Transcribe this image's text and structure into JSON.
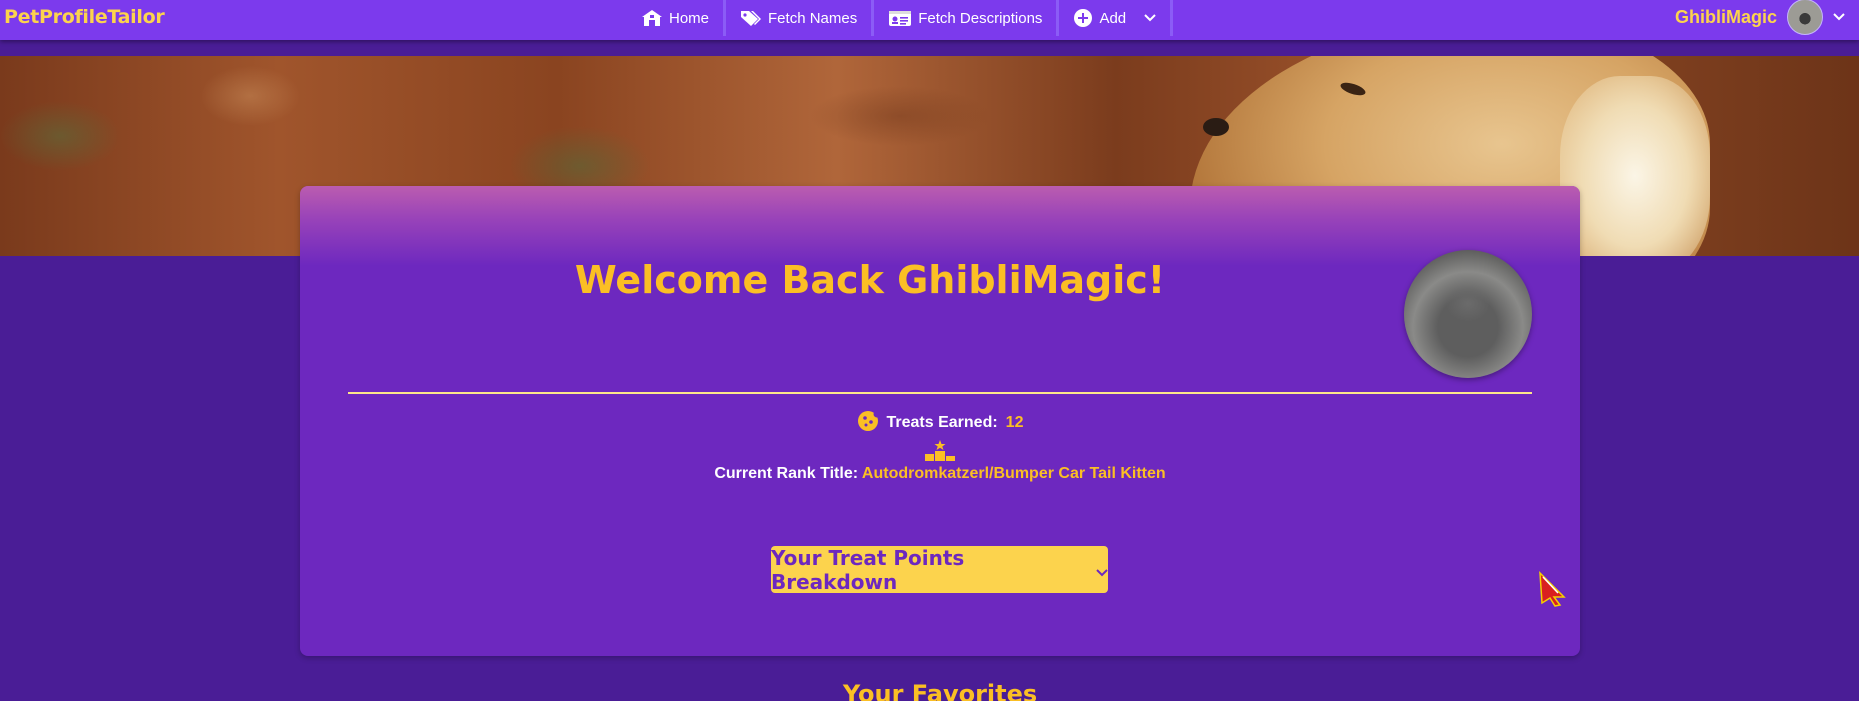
{
  "app": {
    "brand": "PetProfileTailor"
  },
  "nav": {
    "items": [
      {
        "label": "Home",
        "icon": "home-icon"
      },
      {
        "label": "Fetch Names",
        "icon": "tags-icon"
      },
      {
        "label": "Fetch Descriptions",
        "icon": "id-card-icon"
      },
      {
        "label": "Add",
        "icon": "plus-circle-icon"
      }
    ]
  },
  "user": {
    "name": "GhibliMagic"
  },
  "profile": {
    "welcome": "Welcome Back GhibliMagic!",
    "treats_label": "Treats Earned:",
    "treats_value": "12",
    "rank_label": "Current Rank Title:",
    "rank_value": "Autodromkatzerl/Bumper Car Tail Kitten",
    "breakdown_button": "Your Treat Points Breakdown"
  },
  "favorites": {
    "heading": "Your Favorites"
  },
  "colors": {
    "navbar": "#7c3aed",
    "page_bg": "#4a1d96",
    "card_bg": "#6d28bf",
    "accent_gold": "#fbbf24",
    "button_yellow": "#fcd34d"
  }
}
